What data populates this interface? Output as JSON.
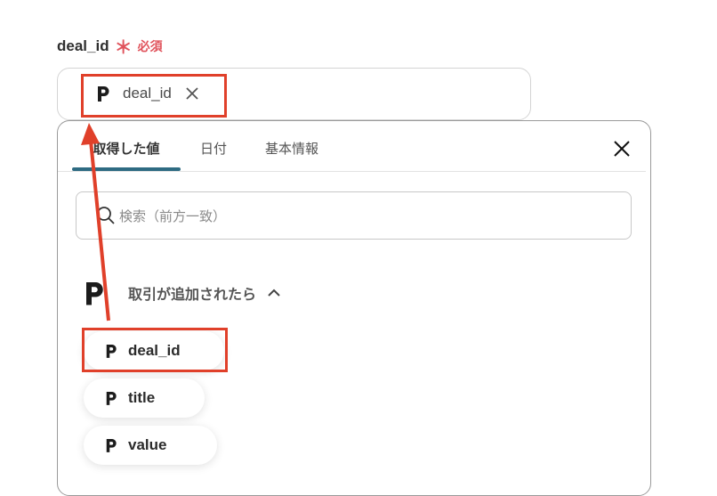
{
  "field": {
    "label": "deal_id",
    "required_mark": "＊",
    "required_text": "必須",
    "selected_chip": {
      "icon": "pipedrive-p-logo",
      "label": "deal_id"
    }
  },
  "panel": {
    "tabs": [
      {
        "label": "取得した値",
        "active": true
      },
      {
        "label": "日付",
        "active": false
      },
      {
        "label": "基本情報",
        "active": false
      }
    ],
    "search_placeholder": "検索（前方一致）",
    "group": {
      "icon": "pipedrive-p-logo",
      "title": "取引が追加されたら",
      "expanded": true
    },
    "items": [
      {
        "label": "deal_id",
        "highlighted": true
      },
      {
        "label": "title",
        "highlighted": false
      },
      {
        "label": "value",
        "highlighted": false
      }
    ]
  },
  "colors": {
    "accent": "#2e6b82",
    "required": "#e0535c",
    "annotation": "#e0402a"
  }
}
